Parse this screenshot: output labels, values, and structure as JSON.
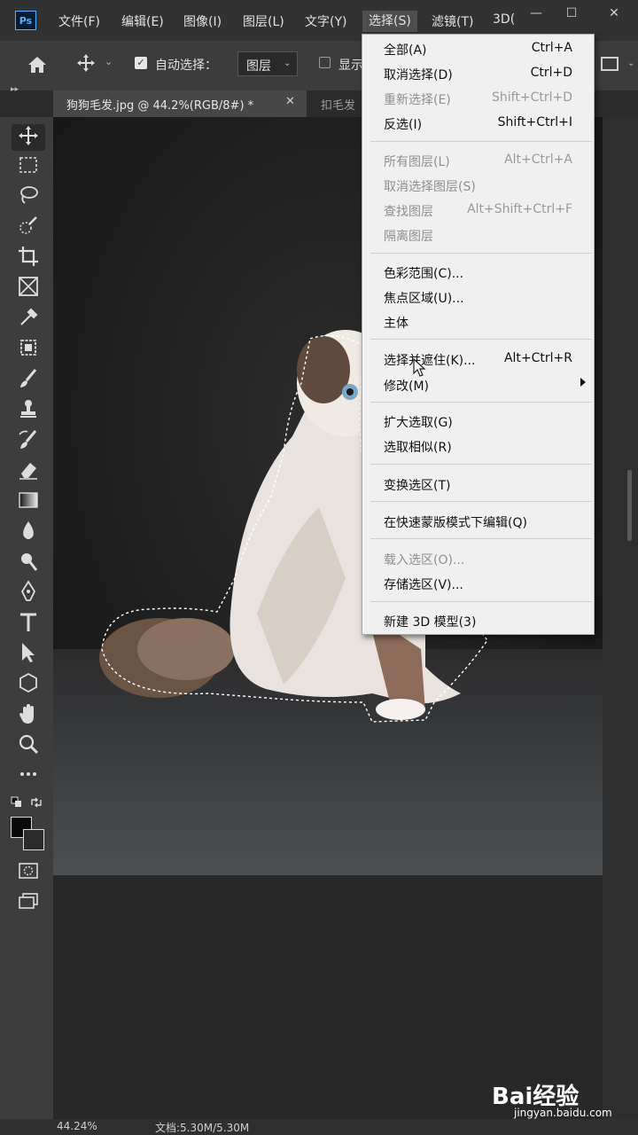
{
  "app": {
    "logo_text": "Ps",
    "menu": [
      "文件(F)",
      "编辑(E)",
      "图像(I)",
      "图层(L)",
      "文字(Y)",
      "选择(S)",
      "滤镜(T)",
      "3D("
    ],
    "active_menu": "选择(S)"
  },
  "options_bar": {
    "auto_select_label": "自动选择：",
    "auto_select_checked": true,
    "layer_select_value": "图层",
    "show_transform_label": "显示"
  },
  "tabs": [
    {
      "label": "狗狗毛发.jpg @ 44.2%(RGB/8#) *",
      "active": true
    },
    {
      "label": "扣毛发",
      "active": false
    }
  ],
  "toolbar": {
    "icons": [
      "move-icon",
      "marquee-icon",
      "lasso-icon",
      "quick-select-icon",
      "crop-icon",
      "frame-icon",
      "eyedropper-icon",
      "healing-icon",
      "brush-icon",
      "stamp-icon",
      "history-brush-icon",
      "eraser-icon",
      "gradient-icon",
      "blur-icon",
      "dodge-icon",
      "pen-icon",
      "type-icon",
      "path-select-icon",
      "shape-icon",
      "hand-icon",
      "zoom-icon",
      "more-icon"
    ],
    "foreground_color": "#0a0a0a",
    "background_color": "#2b2b2b"
  },
  "select_menu": {
    "items": [
      {
        "label": "全部(A)",
        "shortcut": "Ctrl+A",
        "enabled": true
      },
      {
        "label": "取消选择(D)",
        "shortcut": "Ctrl+D",
        "enabled": true
      },
      {
        "label": "重新选择(E)",
        "shortcut": "Shift+Ctrl+D",
        "enabled": false
      },
      {
        "label": "反选(I)",
        "shortcut": "Shift+Ctrl+I",
        "enabled": true
      },
      {
        "label": "所有图层(L)",
        "shortcut": "Alt+Ctrl+A",
        "enabled": false
      },
      {
        "label": "取消选择图层(S)",
        "shortcut": "",
        "enabled": false
      },
      {
        "label": "查找图层",
        "shortcut": "Alt+Shift+Ctrl+F",
        "enabled": false
      },
      {
        "label": "隔离图层",
        "shortcut": "",
        "enabled": false
      },
      {
        "label": "色彩范围(C)...",
        "shortcut": "",
        "enabled": true
      },
      {
        "label": "焦点区域(U)...",
        "shortcut": "",
        "enabled": true
      },
      {
        "label": "主体",
        "shortcut": "",
        "enabled": true
      },
      {
        "label": "选择并遮住(K)...",
        "shortcut": "Alt+Ctrl+R",
        "enabled": true
      },
      {
        "label": "修改(M)",
        "shortcut": "",
        "enabled": true,
        "submenu": true
      },
      {
        "label": "扩大选取(G)",
        "shortcut": "",
        "enabled": true
      },
      {
        "label": "选取相似(R)",
        "shortcut": "",
        "enabled": true
      },
      {
        "label": "变换选区(T)",
        "shortcut": "",
        "enabled": true
      },
      {
        "label": "在快速蒙版模式下编辑(Q)",
        "shortcut": "",
        "enabled": true
      },
      {
        "label": "载入选区(O)...",
        "shortcut": "",
        "enabled": false
      },
      {
        "label": "存储选区(V)...",
        "shortcut": "",
        "enabled": true
      },
      {
        "label": "新建 3D 模型(3)",
        "shortcut": "",
        "enabled": true
      }
    ]
  },
  "status": {
    "zoom": "44.24%",
    "doc": "文档:5.30M/5.30M"
  },
  "watermark": {
    "logo": "Bai经验",
    "url": "jingyan.baidu.com"
  }
}
